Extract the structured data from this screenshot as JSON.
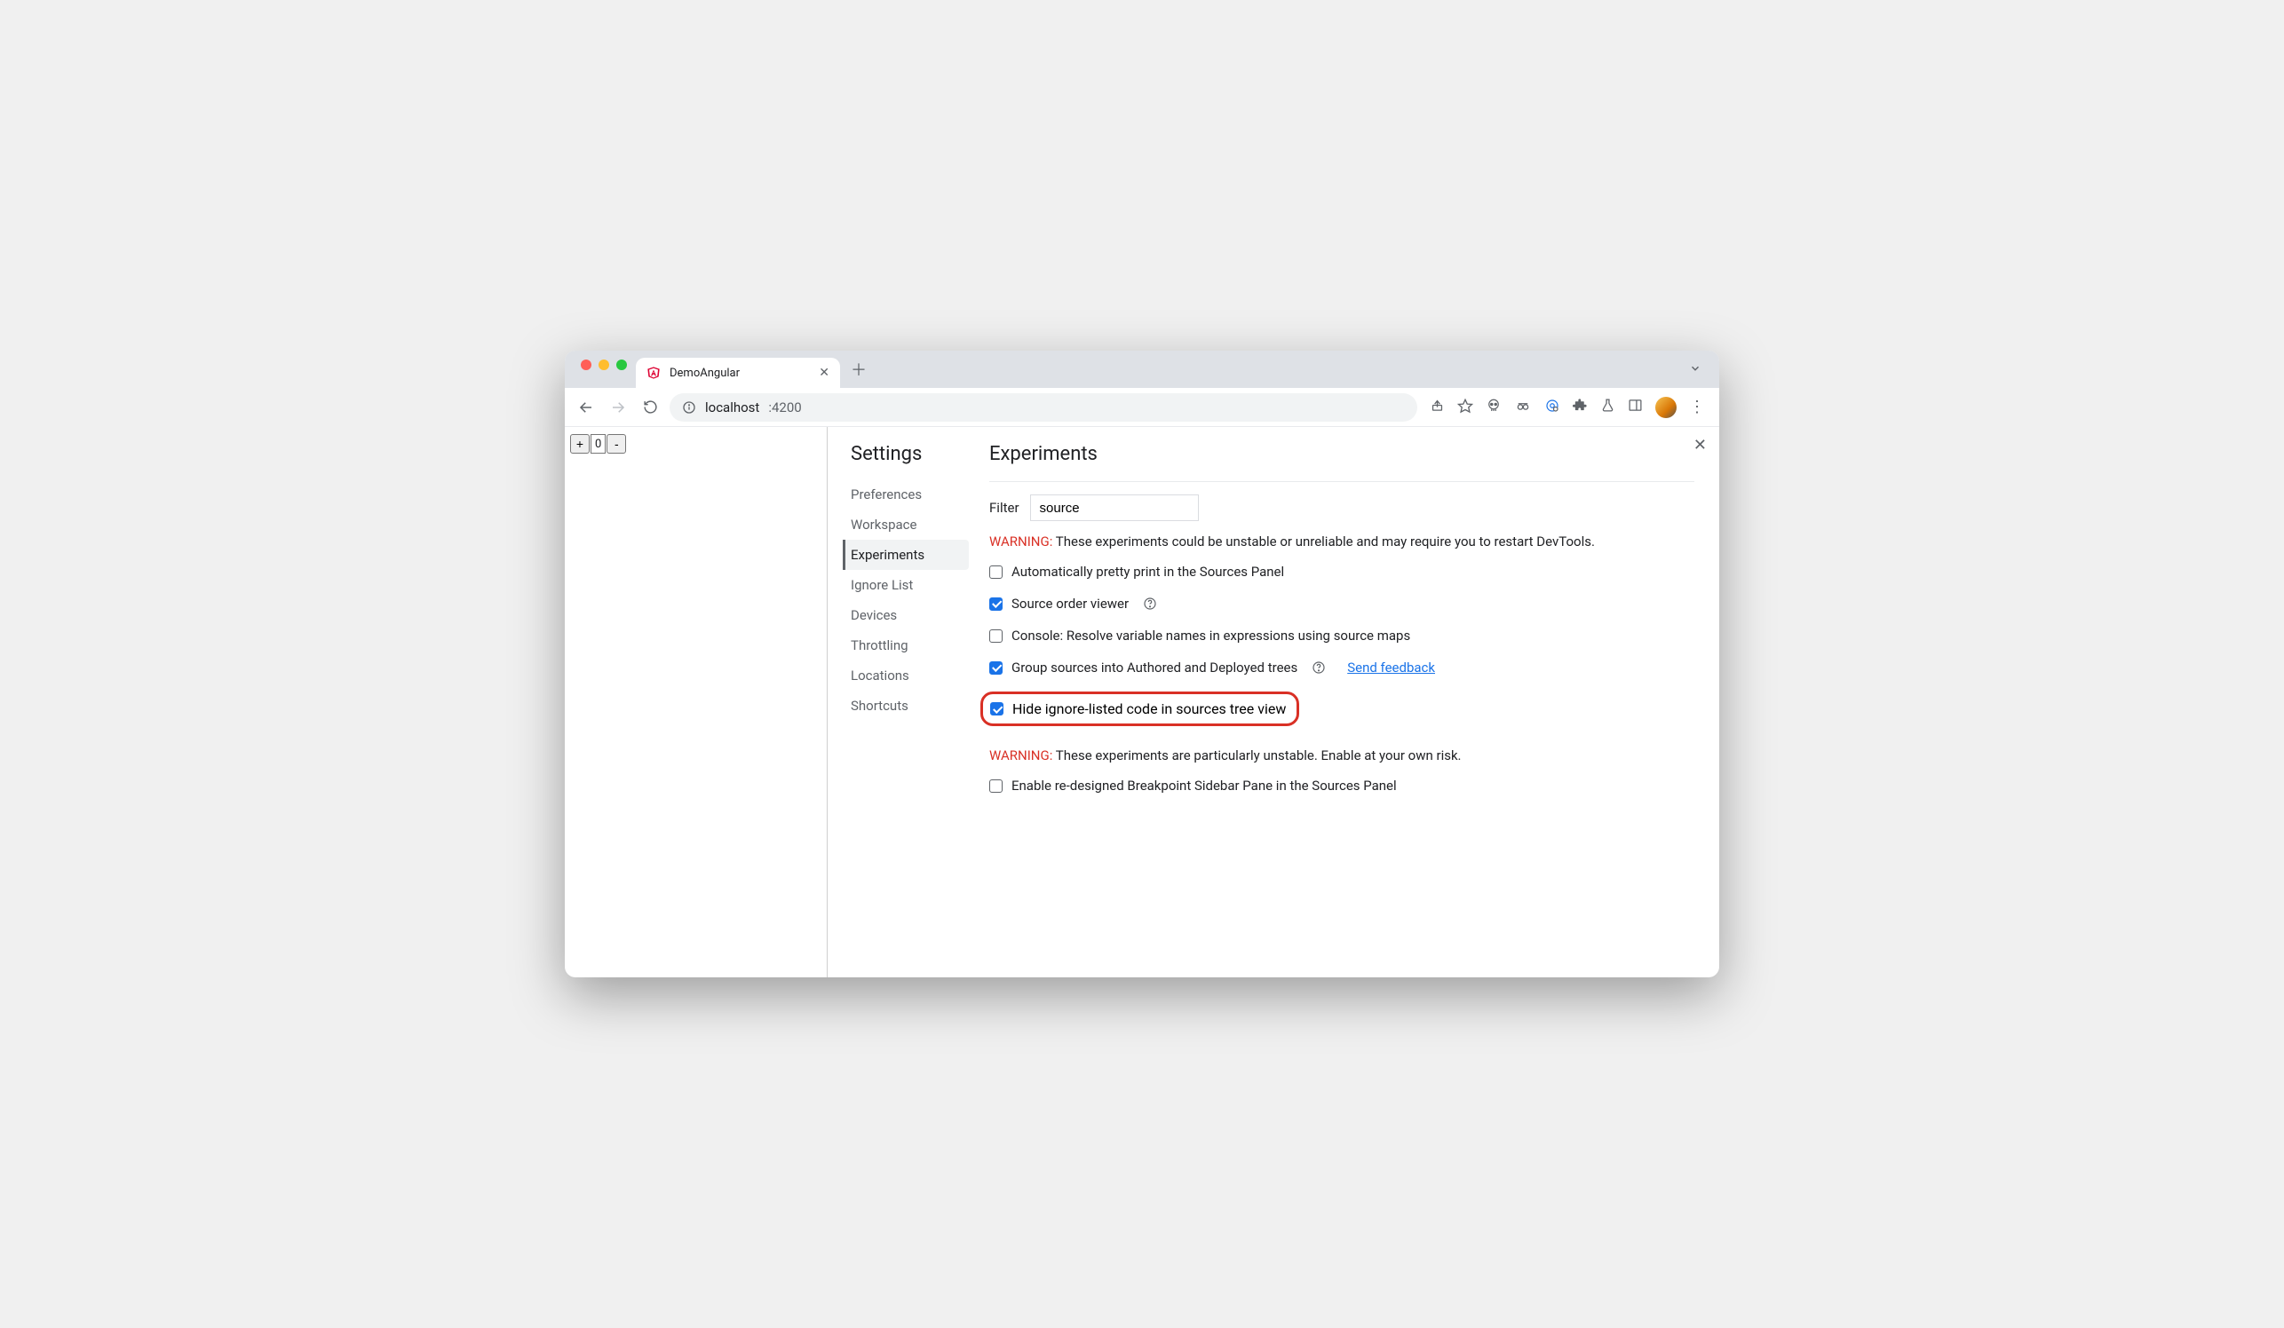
{
  "browser": {
    "tab_title": "DemoAngular",
    "url_host": "localhost",
    "url_port": ":4200"
  },
  "page": {
    "counter_value": "0"
  },
  "settings": {
    "title": "Settings",
    "nav": {
      "preferences": "Preferences",
      "workspace": "Workspace",
      "experiments": "Experiments",
      "ignorelist": "Ignore List",
      "devices": "Devices",
      "throttling": "Throttling",
      "locations": "Locations",
      "shortcuts": "Shortcuts"
    }
  },
  "experiments": {
    "heading": "Experiments",
    "filter_label": "Filter",
    "filter_value": "source",
    "warning1_label": "WARNING:",
    "warning1_text": " These experiments could be unstable or unreliable and may require you to restart DevTools.",
    "items": {
      "pretty_print": "Automatically pretty print in the Sources Panel",
      "source_order": "Source order viewer",
      "console_resolve": "Console: Resolve variable names in expressions using source maps",
      "group_sources": "Group sources into Authored and Deployed trees",
      "hide_ignore": "Hide ignore-listed code in sources tree view",
      "breakpoint_sidebar": "Enable re-designed Breakpoint Sidebar Pane in the Sources Panel"
    },
    "feedback_link": "Send feedback",
    "warning2_label": "WARNING:",
    "warning2_text": " These experiments are particularly unstable. Enable at your own risk."
  }
}
